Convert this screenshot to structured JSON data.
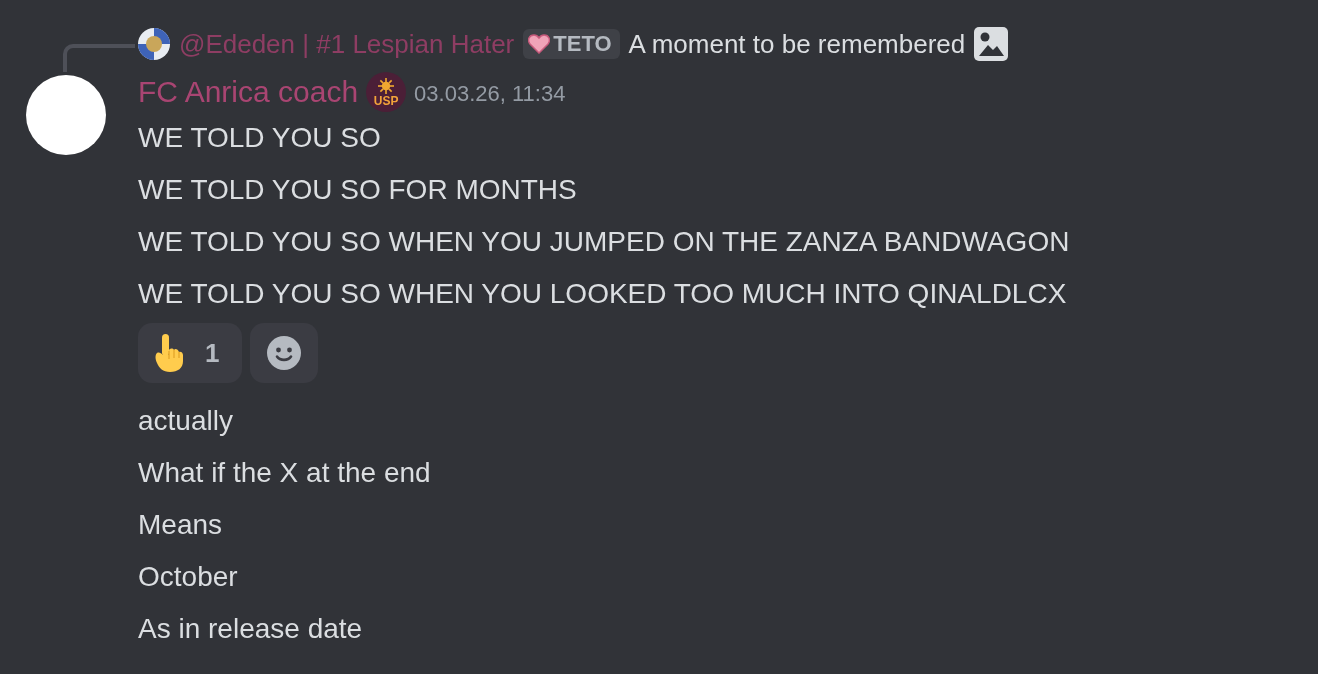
{
  "reply": {
    "author": "@Ededen | #1 Lespian Hater",
    "tag": "TETO",
    "text": "A moment to be remembered",
    "attachment": true
  },
  "message": {
    "author": "FC Anrica coach",
    "role_badge": "USP",
    "timestamp": "03.03.26, 11:34",
    "lines": [
      "WE TOLD YOU SO",
      "WE TOLD YOU SO FOR MONTHS",
      "WE TOLD YOU SO WHEN YOU JUMPED ON THE ZANZA BANDWAGON",
      "WE TOLD YOU SO WHEN YOU LOOKED TOO MUCH INTO QINALDLCX"
    ],
    "reactions": [
      {
        "count": "1",
        "selected": false
      }
    ],
    "followups": [
      "actually",
      "What if the X at the end",
      "Means",
      "October",
      "As in release date"
    ]
  }
}
